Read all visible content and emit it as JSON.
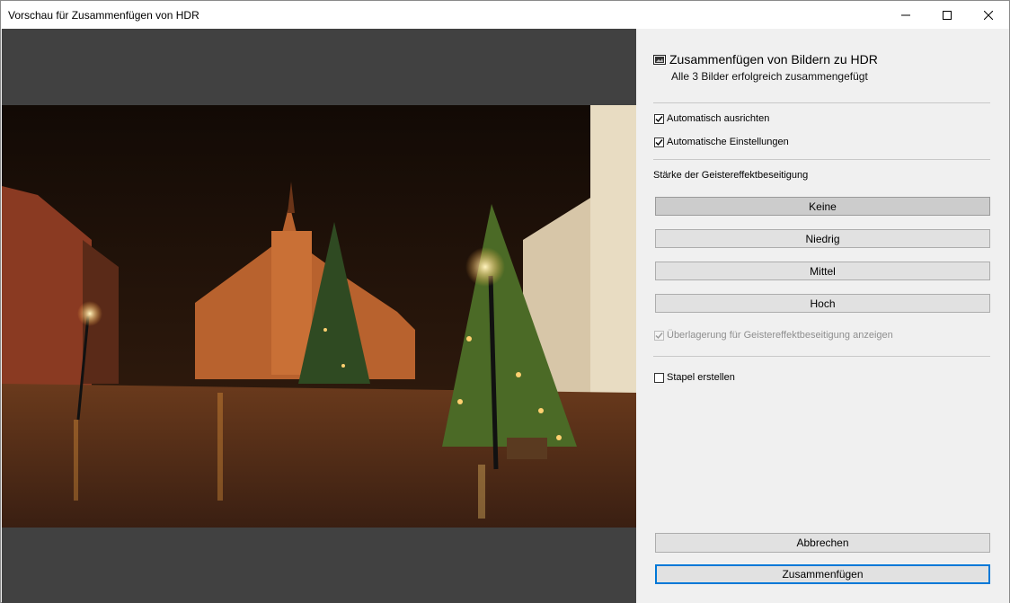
{
  "window": {
    "title": "Vorschau für Zusammenfügen von HDR",
    "minimize_label": "Minimieren",
    "maximize_label": "Maximieren",
    "close_label": "Schließen"
  },
  "panel": {
    "title": "Zusammenfügen von Bildern zu HDR",
    "subtitle": "Alle 3 Bilder erfolgreich zusammengefügt",
    "auto_align": {
      "label": "Automatisch ausrichten",
      "checked": true
    },
    "auto_settings": {
      "label": "Automatische Einstellungen",
      "checked": true
    },
    "deghost_label": "Stärke der Geistereffektbeseitigung",
    "deghost_options": [
      "Keine",
      "Niedrig",
      "Mittel",
      "Hoch"
    ],
    "deghost_selected": "Keine",
    "overlay": {
      "label": "Überlagerung für Geistereffektbeseitigung anzeigen",
      "checked": true,
      "disabled": true
    },
    "stack": {
      "label": "Stapel erstellen",
      "checked": false
    },
    "cancel_label": "Abbrechen",
    "merge_label": "Zusammenfügen"
  },
  "colors": {
    "accent": "#0078d7",
    "preview_bg": "#414141",
    "panel_bg": "#f0f0f0"
  }
}
